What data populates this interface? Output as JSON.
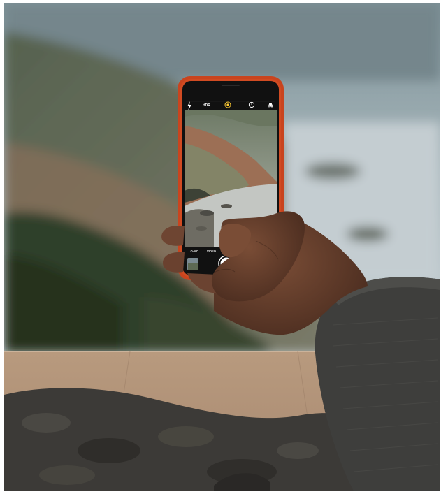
{
  "scene": {
    "description_tags": [
      "photo",
      "hand-holding-phone",
      "coastal-landscape",
      "camera-app"
    ]
  },
  "camera_app": {
    "top_bar": {
      "flash_icon": "flash-icon",
      "hdr_label": "HDR",
      "live_icon": "live-photo-icon",
      "timer_icon": "timer-icon",
      "filter_icon": "filter-icon"
    },
    "modes": [
      "LO-MO",
      "VIDEO",
      "PHOTO",
      "PAN"
    ],
    "active_mode": "PHOTO",
    "shutter_icon": "shutter-button-icon",
    "flip_icon": "flip-camera-icon",
    "thumbnail_icon": "last-photo-thumbnail"
  },
  "colors": {
    "phone_case": "#d2461f",
    "sky": "#9fb0b6",
    "sea": "#c9d1d4",
    "hill": "#5d6a58",
    "table": "#b89a7d",
    "sweater": "#3d3d3b",
    "skin": "#6b4330"
  }
}
